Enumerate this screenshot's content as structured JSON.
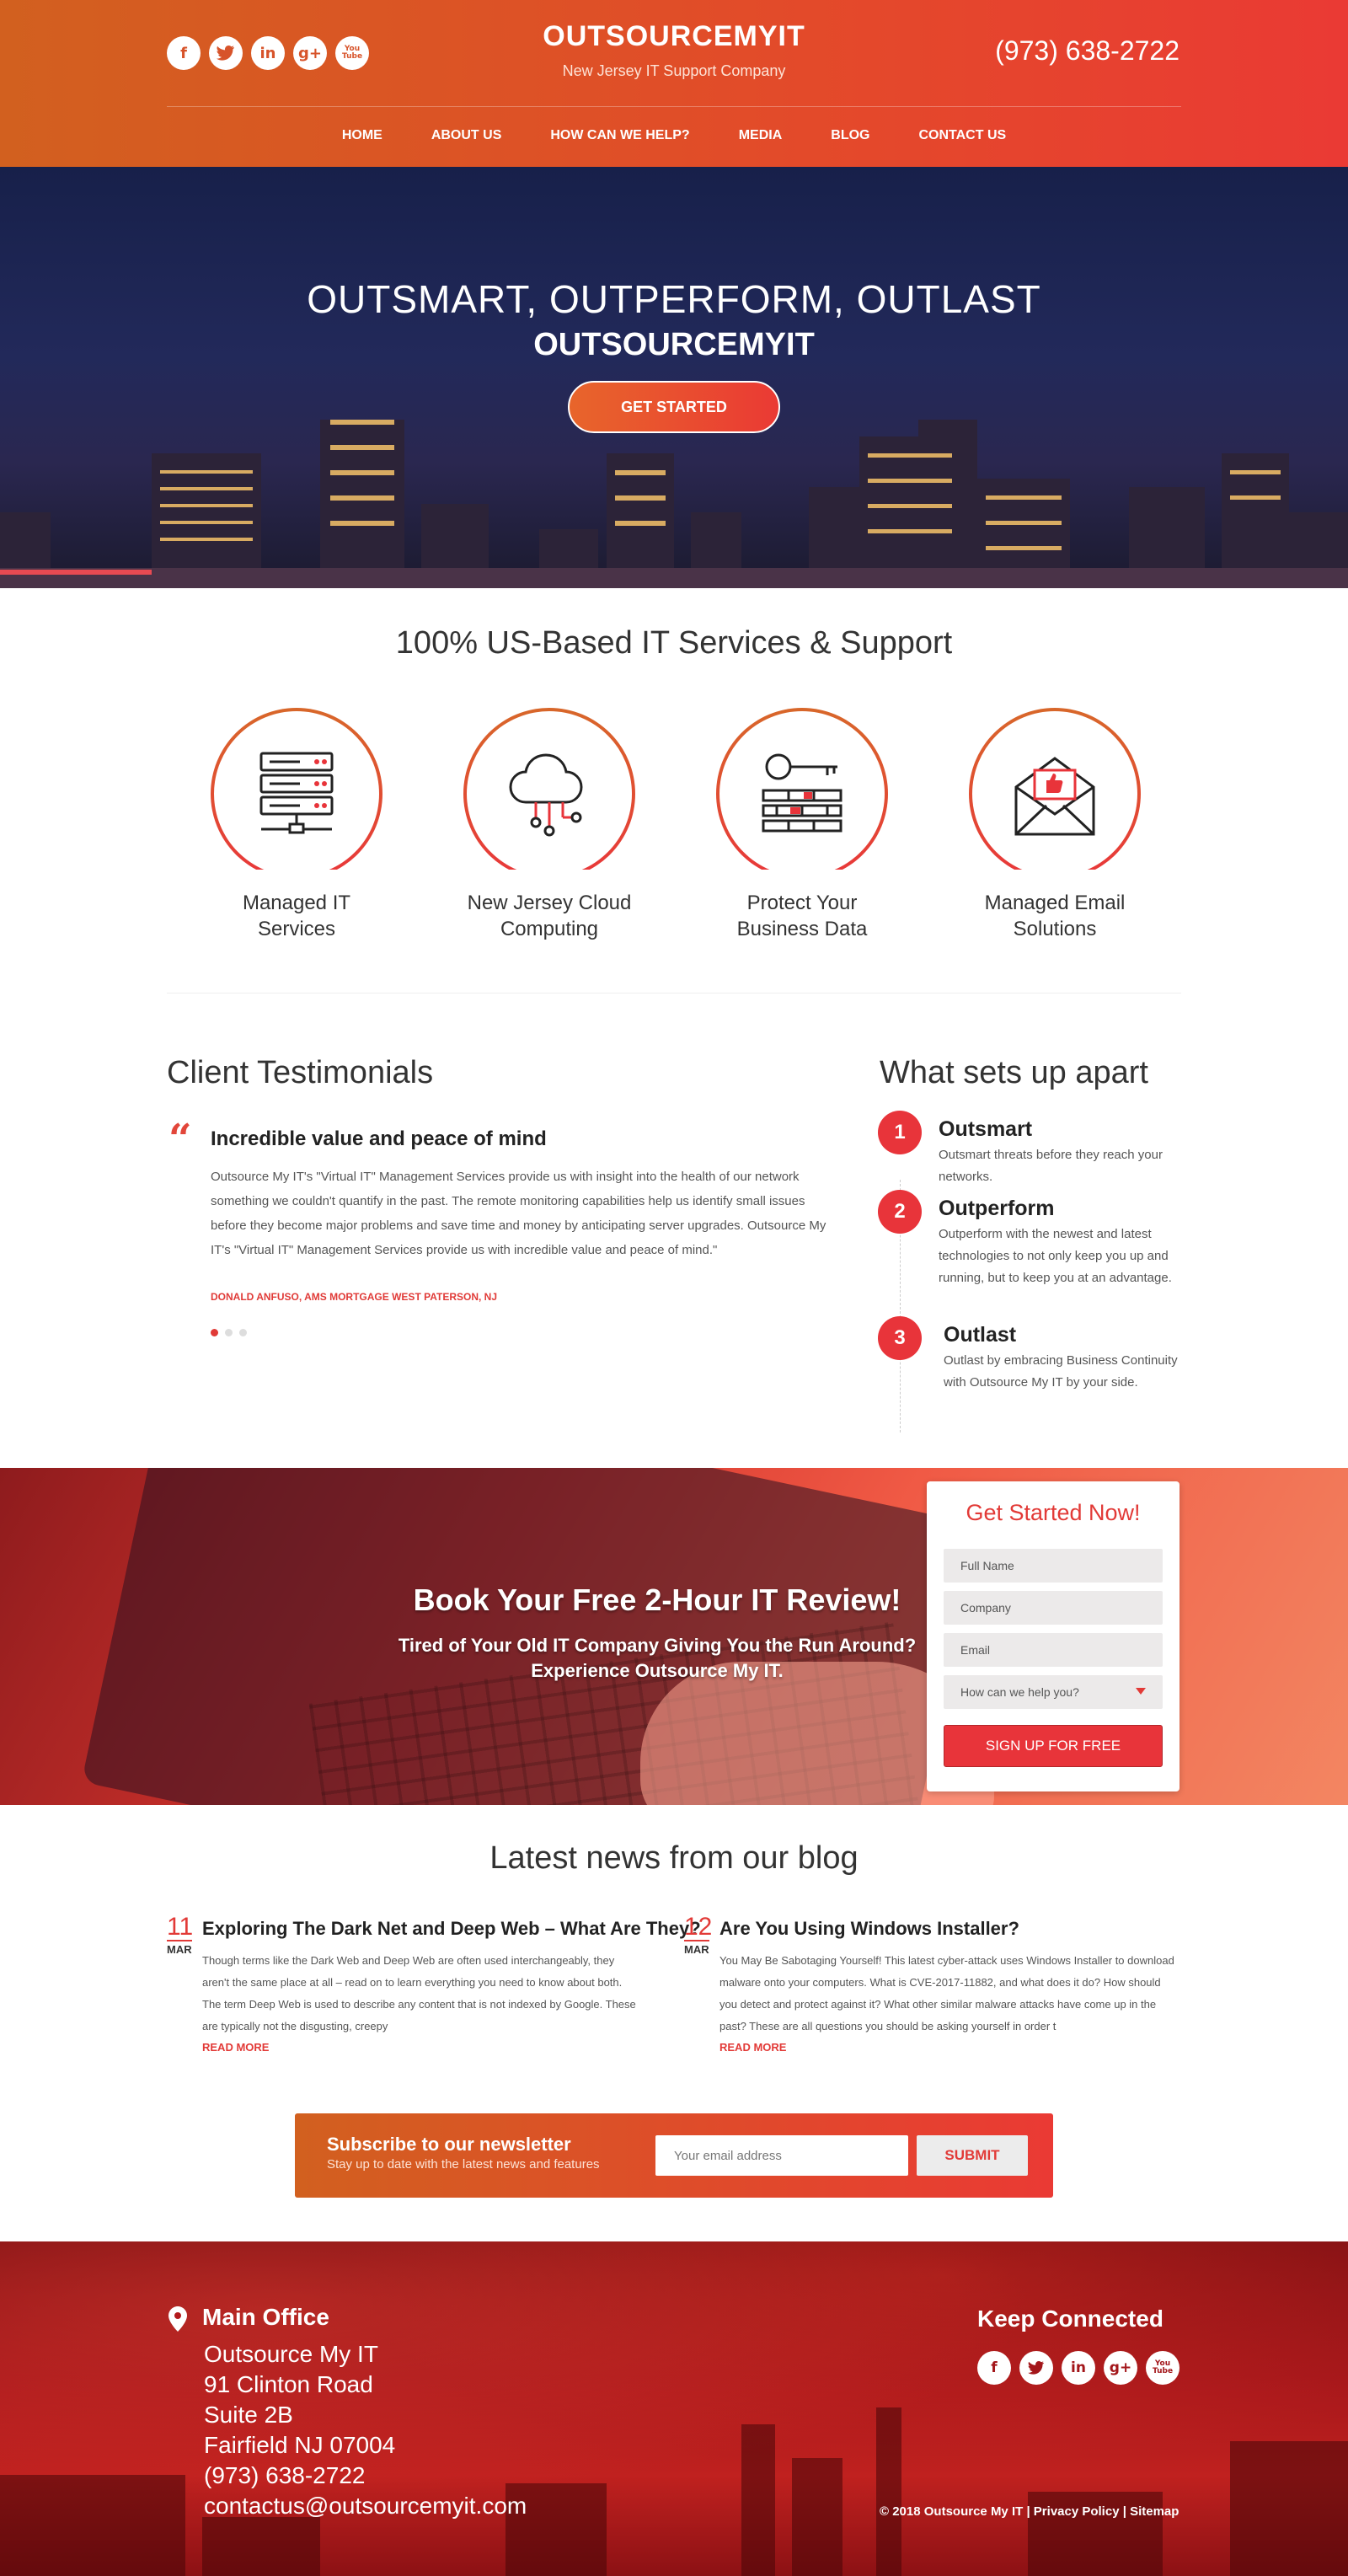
{
  "header": {
    "brand": "OUTSOURCEMYIT",
    "tagline": "New Jersey IT Support Company",
    "phone": "(973) 638-2722",
    "social": [
      "f",
      "t",
      "in",
      "g+",
      "You Tube"
    ],
    "social_names": [
      "facebook-icon",
      "twitter-icon",
      "linkedin-icon",
      "google-plus-icon",
      "youtube-icon"
    ]
  },
  "nav": [
    "HOME",
    "ABOUT US",
    "HOW CAN WE HELP?",
    "MEDIA",
    "BLOG",
    "CONTACT US"
  ],
  "hero": {
    "title": "OUTSMART, OUTPERFORM, OUTLAST",
    "subtitle": "OUTSOURCEMYIT",
    "button": "GET STARTED"
  },
  "services": {
    "title": "100% US-Based IT Services & Support",
    "items": [
      {
        "label": "Managed IT Services",
        "icon": "server-icon"
      },
      {
        "label": "New Jersey Cloud Computing",
        "icon": "cloud-icon"
      },
      {
        "label": "Protect Your Business Data",
        "icon": "key-firewall-icon"
      },
      {
        "label": "Managed Email Solutions",
        "icon": "email-icon"
      }
    ]
  },
  "testimonials": {
    "title": "Client Testimonials",
    "headline": "Incredible value and peace of mind",
    "body": "Outsource My IT's \"Virtual IT\" Management Services provide us with insight into the health of our network something we couldn't quantify in the past. The remote monitoring capabilities help us identify small issues before they become major problems and save time and money by anticipating server upgrades. Outsource My IT's \"Virtual IT\" Management Services provide us with incredible value and peace of mind.\"",
    "author": "DONALD ANFUSO, AMS MORTGAGE WEST PATERSON, NJ"
  },
  "apart": {
    "title": "What sets up apart",
    "steps": [
      {
        "num": "1",
        "title": "Outsmart",
        "desc": "Outsmart threats before they reach your networks."
      },
      {
        "num": "2",
        "title": "Outperform",
        "desc": "Outperform with the newest and latest technologies to not only keep you up and running, but to keep you at an advantage."
      },
      {
        "num": "3",
        "title": "Outlast",
        "desc": "Outlast by embracing Business Continuity with Outsource My IT by your side."
      }
    ]
  },
  "cta": {
    "title": "Book Your Free 2-Hour IT Review!",
    "line1": "Tired of Your Old IT Company Giving You the Run Around?",
    "line2": "Experience Outsource My IT.",
    "form": {
      "title": "Get Started Now!",
      "full_name": "Full Name",
      "company": "Company",
      "email": "Email",
      "help": "How can we help you?",
      "submit": "SIGN UP FOR FREE"
    }
  },
  "blog": {
    "title": "Latest news from our blog",
    "posts": [
      {
        "day": "11",
        "month": "MAR",
        "title": "Exploring The Dark Net and Deep Web – What Are They?",
        "excerpt": "Though terms like the Dark Web and Deep Web are often used interchangeably, they aren't the same place at all – read on to learn everything you need to know about both. The term Deep Web is used to describe any content that is not indexed by Google. These are typically not the disgusting, creepy",
        "more": "READ MORE"
      },
      {
        "day": "12",
        "month": "MAR",
        "title": "Are You Using Windows Installer?",
        "excerpt": "You May Be Sabotaging Yourself! This latest cyber-attack uses Windows Installer to download malware onto your computers. What is CVE-2017-11882, and what does it do? How should you detect and protect against it? What other similar malware attacks have come up in the past? These are all questions you should be asking yourself in order t",
        "more": "READ MORE"
      }
    ]
  },
  "newsletter": {
    "title": "Subscribe to our newsletter",
    "subtitle": "Stay up to date with the latest news and features",
    "placeholder": "Your email address",
    "button": "SUBMIT"
  },
  "footer": {
    "office_title": "Main Office",
    "lines": [
      "Outsource My IT",
      "91 Clinton Road",
      "Suite 2B",
      "Fairfield NJ 07004",
      "(973) 638-2722",
      "contactus@outsourcemyit.com"
    ],
    "connect_title": "Keep Connected",
    "copyright": "© 2018 Outsource My IT | Privacy Policy | Sitemap"
  },
  "colors": {
    "accent": "#e8343a",
    "brand_orange": "#d2601f"
  }
}
